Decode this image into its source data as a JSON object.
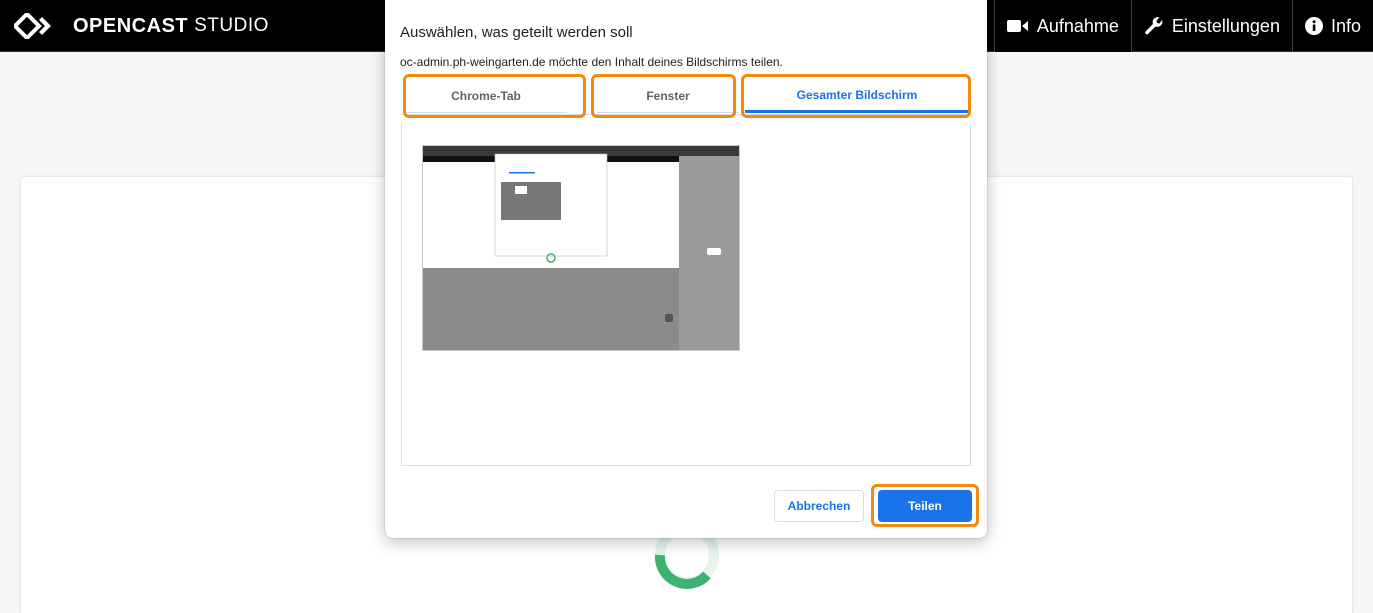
{
  "header": {
    "brand": "OPENCAST",
    "brand_suffix": "STUDIO",
    "nav": [
      {
        "label": "Aufnahme",
        "icon": "video-camera-icon"
      },
      {
        "label": "Einstellungen",
        "icon": "wrench-icon"
      },
      {
        "label": "Info",
        "icon": "info-circle-icon"
      }
    ]
  },
  "dialog": {
    "title": "Auswählen, was geteilt werden soll",
    "subtitle": "oc-admin.ph-weingarten.de möchte den Inhalt deines Bildschirms teilen.",
    "tabs": [
      {
        "label": "Chrome-Tab",
        "selected": false
      },
      {
        "label": "Fenster",
        "selected": false
      },
      {
        "label": "Gesamter Bildschirm",
        "selected": true
      }
    ],
    "cancel_label": "Abbrechen",
    "share_label": "Teilen"
  },
  "colors": {
    "accent": "#1a73e8",
    "highlight": "#f08a10",
    "header_bg": "#000000",
    "spinner": "#3cb371"
  }
}
